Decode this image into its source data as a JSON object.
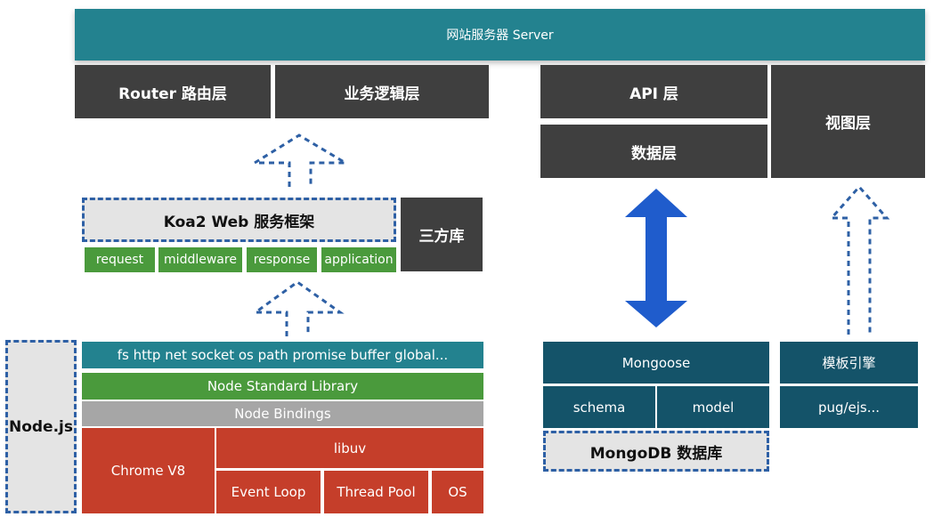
{
  "server": {
    "label": "网站服务器 Server"
  },
  "layers": {
    "router": "Router 路由层",
    "business": "业务逻辑层",
    "api": "API 层",
    "data": "数据层",
    "view": "视图层"
  },
  "koa": {
    "title": "Koa2 Web 服务框架",
    "third_party": "三方库",
    "modules": [
      "request",
      "middleware",
      "response",
      "application"
    ]
  },
  "node": {
    "label": "Node.js",
    "core_modules": "fs http net socket os path promise buffer global...",
    "standard_library": "Node Standard Library",
    "bindings": "Node Bindings",
    "v8": "Chrome V8",
    "libuv": "libuv",
    "event_loop": "Event Loop",
    "thread_pool": "Thread Pool",
    "os": "OS"
  },
  "database": {
    "mongoose": "Mongoose",
    "schema": "schema",
    "model": "model",
    "mongodb": "MongoDB 数据库"
  },
  "template": {
    "engine": "模板引擎",
    "engines": "pug/ejs..."
  },
  "colors": {
    "server": "#23828f",
    "dark": "#3f3f3f",
    "green": "#4a9a3c",
    "navy": "#145369",
    "red": "#c53e2a",
    "gray": "#a6a6a6",
    "dashed_border": "#2e60a5",
    "arrow_solid": "#1f5ccc"
  }
}
